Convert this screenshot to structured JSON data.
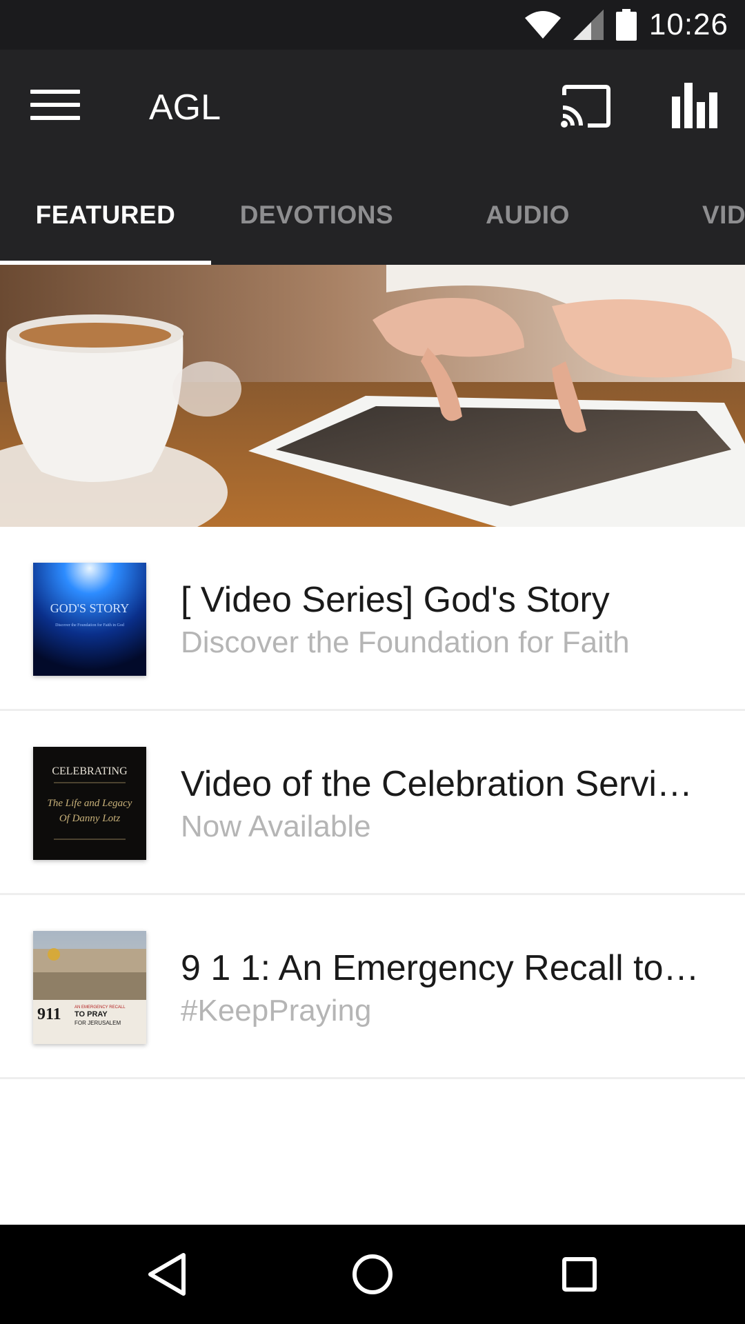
{
  "status_bar": {
    "time": "10:26",
    "icons": [
      "wifi-icon",
      "cell-signal-icon",
      "battery-icon"
    ]
  },
  "app_bar": {
    "title": "AGL",
    "icons": [
      "menu-icon",
      "cast-icon",
      "stats-icon"
    ]
  },
  "tabs": [
    {
      "label": "FEATURED",
      "active": true
    },
    {
      "label": "DEVOTIONS",
      "active": false
    },
    {
      "label": "AUDIO",
      "active": false
    },
    {
      "label": "VIDEO",
      "active": false
    }
  ],
  "items": [
    {
      "title": "[ Video Series] God's Story",
      "subtitle": "Discover the Foundation for Faith",
      "thumb": {
        "heading": "GOD'S STORY",
        "caption": "Discover the Foundation for Faith in God"
      }
    },
    {
      "title": "Video of the Celebration Servi…",
      "subtitle": "Now Available",
      "thumb": {
        "heading": "CELEBRATING",
        "line1": "The Life and Legacy",
        "line2": "Of Danny Lotz"
      }
    },
    {
      "title": "9 1 1: An Emergency Recall to…",
      "subtitle": "#KeepPraying",
      "thumb": {
        "number": "911",
        "line1": "AN EMERGENCY RECALL",
        "line2": "TO PRAY",
        "line3": "FOR JERUSALEM"
      }
    }
  ],
  "nav_bar": {
    "icons": [
      "back-icon",
      "home-icon",
      "recents-icon"
    ]
  },
  "colors": {
    "app_bar": "#232325",
    "status_bar": "#1b1b1d",
    "tab_inactive": "#8e8e90",
    "subtitle": "#b5b5b5"
  }
}
